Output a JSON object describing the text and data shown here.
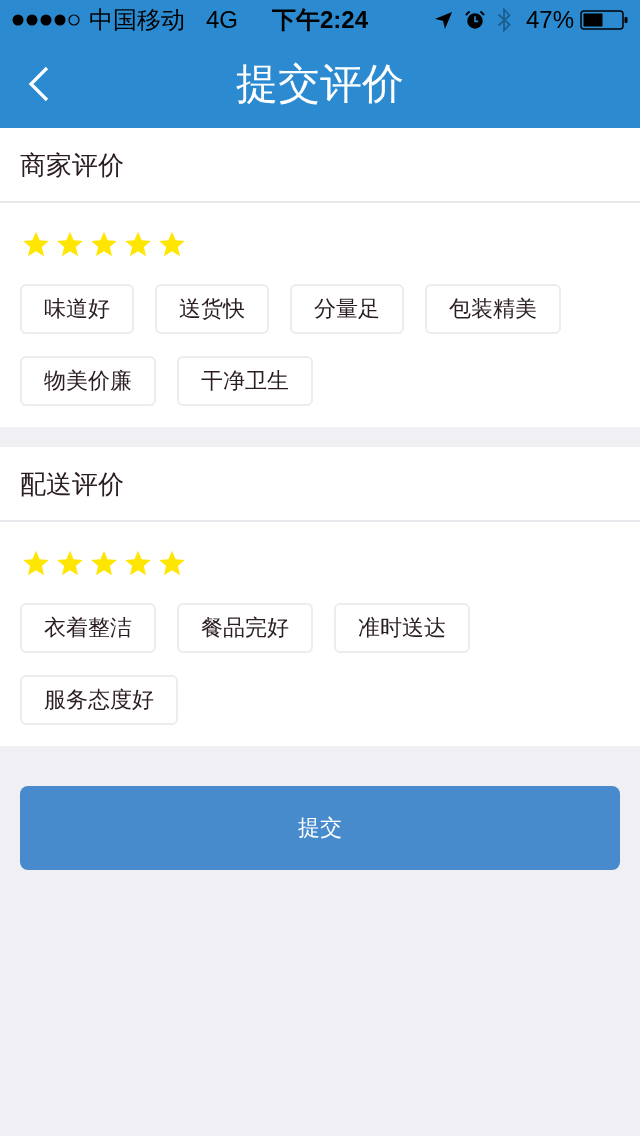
{
  "status_bar": {
    "carrier": "中国移动",
    "network": "4G",
    "time": "下午2:24",
    "battery": "47%"
  },
  "nav": {
    "title": "提交评价"
  },
  "sections": [
    {
      "title": "商家评价",
      "stars": 5,
      "tags": [
        {
          "label": "味道好",
          "selected": false
        },
        {
          "label": "送货快",
          "selected": false
        },
        {
          "label": "分量足",
          "selected": false
        },
        {
          "label": "包装精美",
          "selected": false
        },
        {
          "label": "物美价廉",
          "selected": false
        },
        {
          "label": "干净卫生",
          "selected": false
        }
      ]
    },
    {
      "title": "配送评价",
      "stars": 5,
      "tags": [
        {
          "label": "衣着整洁",
          "selected": false
        },
        {
          "label": "餐品完好",
          "selected": false
        },
        {
          "label": "准时送达",
          "selected": false
        },
        {
          "label": "服务态度好",
          "selected": false
        }
      ]
    }
  ],
  "submit_button": "提交"
}
